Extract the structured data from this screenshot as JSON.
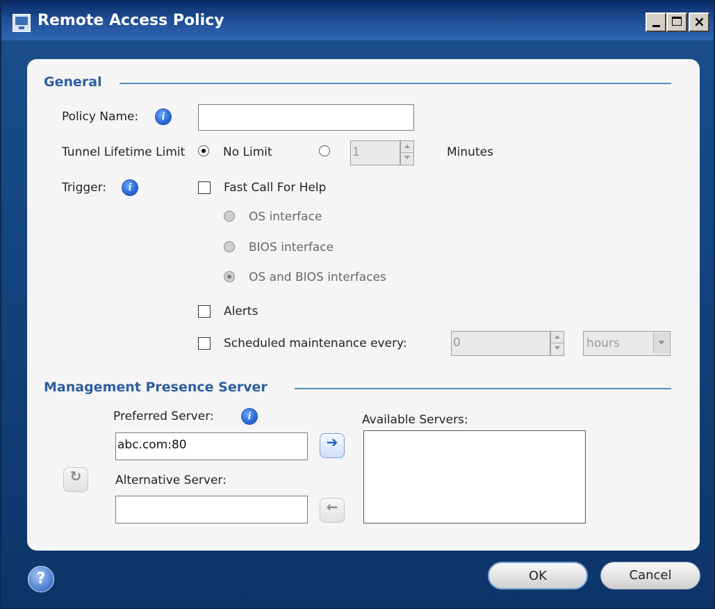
{
  "window": {
    "title": "Remote Access Policy"
  },
  "general": {
    "section_title": "General",
    "policy_name_label": "Policy Name:",
    "policy_name_value": "",
    "tunnel_label": "Tunnel Lifetime Limit",
    "no_limit_label": "No Limit",
    "tunnel_minutes_value": "1",
    "minutes_label": "Minutes",
    "trigger_label": "Trigger:",
    "fast_call_label": "Fast Call For Help",
    "os_interface_label": "OS interface",
    "bios_interface_label": "BIOS interface",
    "os_bios_label": "OS and BIOS interfaces",
    "alerts_label": "Alerts",
    "scheduled_label": "Scheduled maintenance every:",
    "scheduled_value": "0",
    "scheduled_unit": "hours"
  },
  "mps": {
    "section_title": "Management Presence Server",
    "preferred_label": "Preferred Server:",
    "preferred_value": "abc.com:80",
    "alternative_label": "Alternative Server:",
    "alternative_value": "",
    "available_label": "Available Servers:"
  },
  "footer": {
    "help_glyph": "?",
    "ok_label": "OK",
    "cancel_label": "Cancel"
  },
  "icons": {
    "info": "info-icon",
    "arrow_right": "arrow-right-icon",
    "arrow_left": "arrow-left-icon",
    "swap": "swap-icon",
    "help": "help-icon"
  },
  "colors": {
    "accent": "#2e5e9e",
    "titlebar": "#1f4f96"
  }
}
